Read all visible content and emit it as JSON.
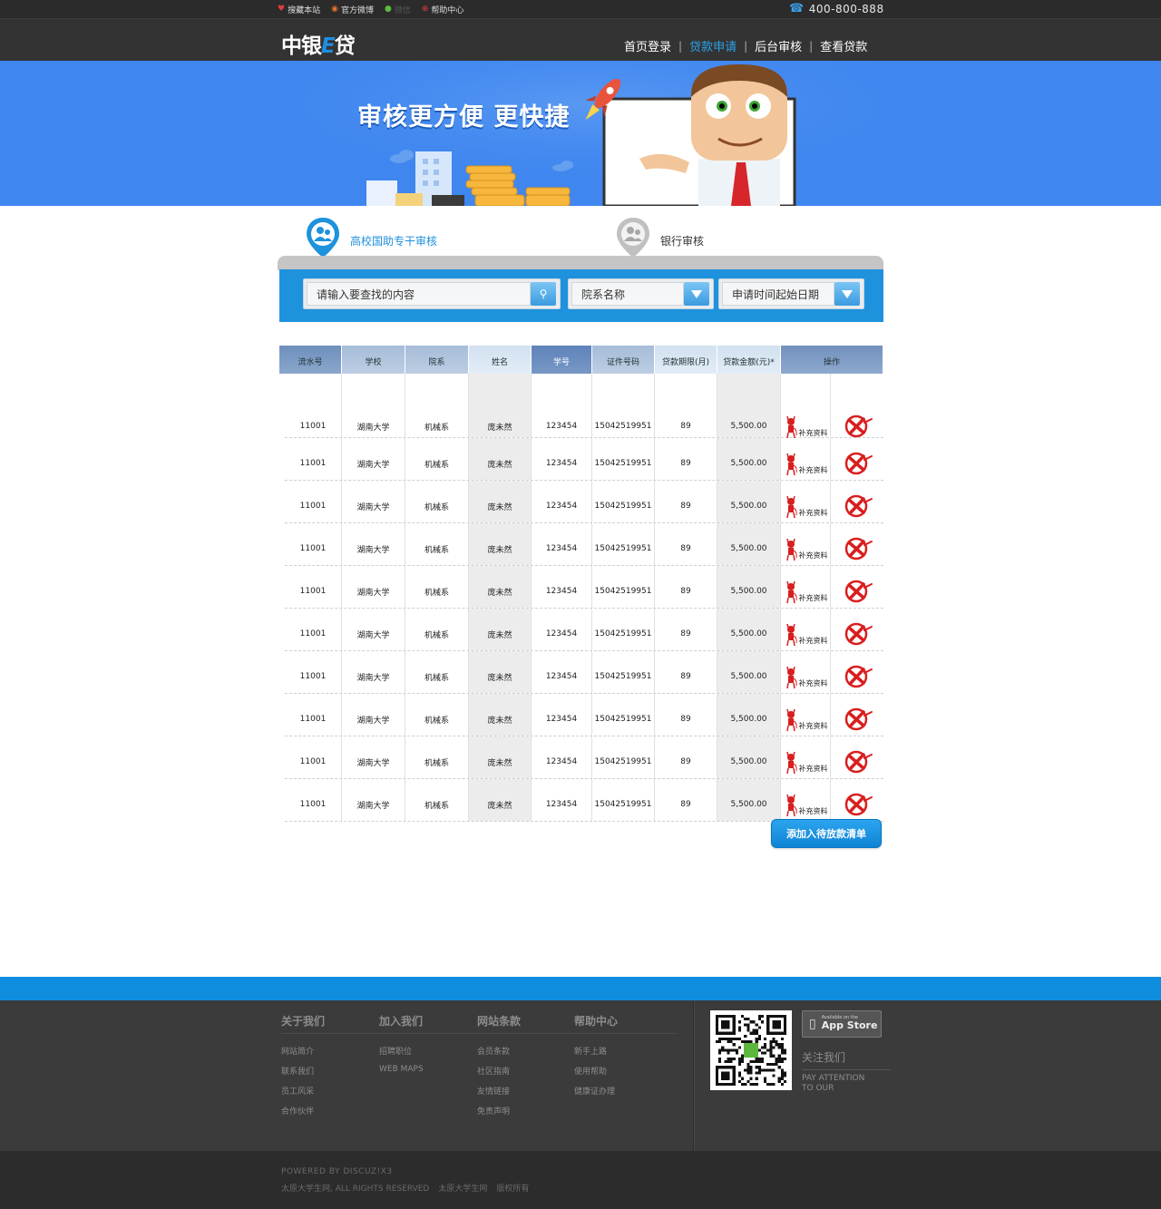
{
  "topbar": {
    "links": [
      {
        "icon": "heart-icon",
        "label": "搜藏本站"
      },
      {
        "icon": "weibo-icon",
        "label": "官方微博"
      },
      {
        "icon": "wechat-icon",
        "label": "微信"
      },
      {
        "icon": "help-icon",
        "label": "帮助中心"
      }
    ],
    "phone": "400-800-888"
  },
  "header": {
    "logo_main": "中银",
    "logo_e": "E",
    "logo_tail": "贷",
    "nav": [
      {
        "label": "首页登录",
        "active": false
      },
      {
        "label": "贷款申请",
        "active": true
      },
      {
        "label": "后台审核",
        "active": false
      },
      {
        "label": "查看贷款",
        "active": false
      }
    ]
  },
  "banner": {
    "slogan": "审核更方便 更快捷"
  },
  "steps": [
    {
      "label": "高校国助专干审核",
      "active": true
    },
    {
      "label": "银行审核",
      "active": false
    }
  ],
  "search": {
    "query_placeholder": "请输入要查找的内容",
    "dept_select": "院系名称",
    "date_select": "申请时间起始日期"
  },
  "table": {
    "columns": [
      "流水号",
      "学校",
      "院系",
      "姓名",
      "学号",
      "证件号码",
      "贷款期限(月)",
      "贷款金额(元)*",
      "操作"
    ],
    "rows": [
      [
        "11001",
        "湖南大学",
        "机械系",
        "庞未然",
        "123454",
        "15042519951",
        "89",
        "5,500.00"
      ],
      [
        "11001",
        "湖南大学",
        "机械系",
        "庞未然",
        "123454",
        "15042519951",
        "89",
        "5,500.00"
      ],
      [
        "11001",
        "湖南大学",
        "机械系",
        "庞未然",
        "123454",
        "15042519951",
        "89",
        "5,500.00"
      ],
      [
        "11001",
        "湖南大学",
        "机械系",
        "庞未然",
        "123454",
        "15042519951",
        "89",
        "5,500.00"
      ],
      [
        "11001",
        "湖南大学",
        "机械系",
        "庞未然",
        "123454",
        "15042519951",
        "89",
        "5,500.00"
      ],
      [
        "11001",
        "湖南大学",
        "机械系",
        "庞未然",
        "123454",
        "15042519951",
        "89",
        "5,500.00"
      ],
      [
        "11001",
        "湖南大学",
        "机械系",
        "庞未然",
        "123454",
        "15042519951",
        "89",
        "5,500.00"
      ],
      [
        "11001",
        "湖南大学",
        "机械系",
        "庞未然",
        "123454",
        "15042519951",
        "89",
        "5,500.00"
      ],
      [
        "11001",
        "湖南大学",
        "机械系",
        "庞未然",
        "123454",
        "15042519951",
        "89",
        "5,500.00"
      ],
      [
        "11001",
        "湖南大学",
        "机械系",
        "庞未然",
        "123454",
        "15042519951",
        "89",
        "5,500.00"
      ]
    ],
    "supplement_label": "补充资料"
  },
  "add_button": "添加入待放款清单",
  "footer": {
    "columns": [
      {
        "head": "关于我们",
        "links": [
          "网站简介",
          "联系我们",
          "员工风采",
          "合作伙伴"
        ]
      },
      {
        "head": "加入我们",
        "links": [
          "招聘职位",
          "WEB MAPS"
        ]
      },
      {
        "head": "网站条款",
        "links": [
          "会员条款",
          "社区指南",
          "友情链接",
          "免责声明"
        ]
      },
      {
        "head": "帮助中心",
        "links": [
          "新手上路",
          "使用帮助",
          "健康证办理"
        ]
      }
    ],
    "appstore_small": "Available on the",
    "appstore_big": "App Store",
    "follow_head": "关注我们",
    "follow_sub1": "PAY ATTENTION",
    "follow_sub2": "TO OUR",
    "powered": "POWERED BY DISCUZ!X3",
    "copyright": [
      "太原大学生网, ALL RIGHTS RESERVED",
      "太原大学生网",
      "版权所有"
    ]
  },
  "colors": {
    "accent": "#1e92dc",
    "banner": "#3f86ef",
    "header": "#333333",
    "footer": "#3b3b3b"
  }
}
